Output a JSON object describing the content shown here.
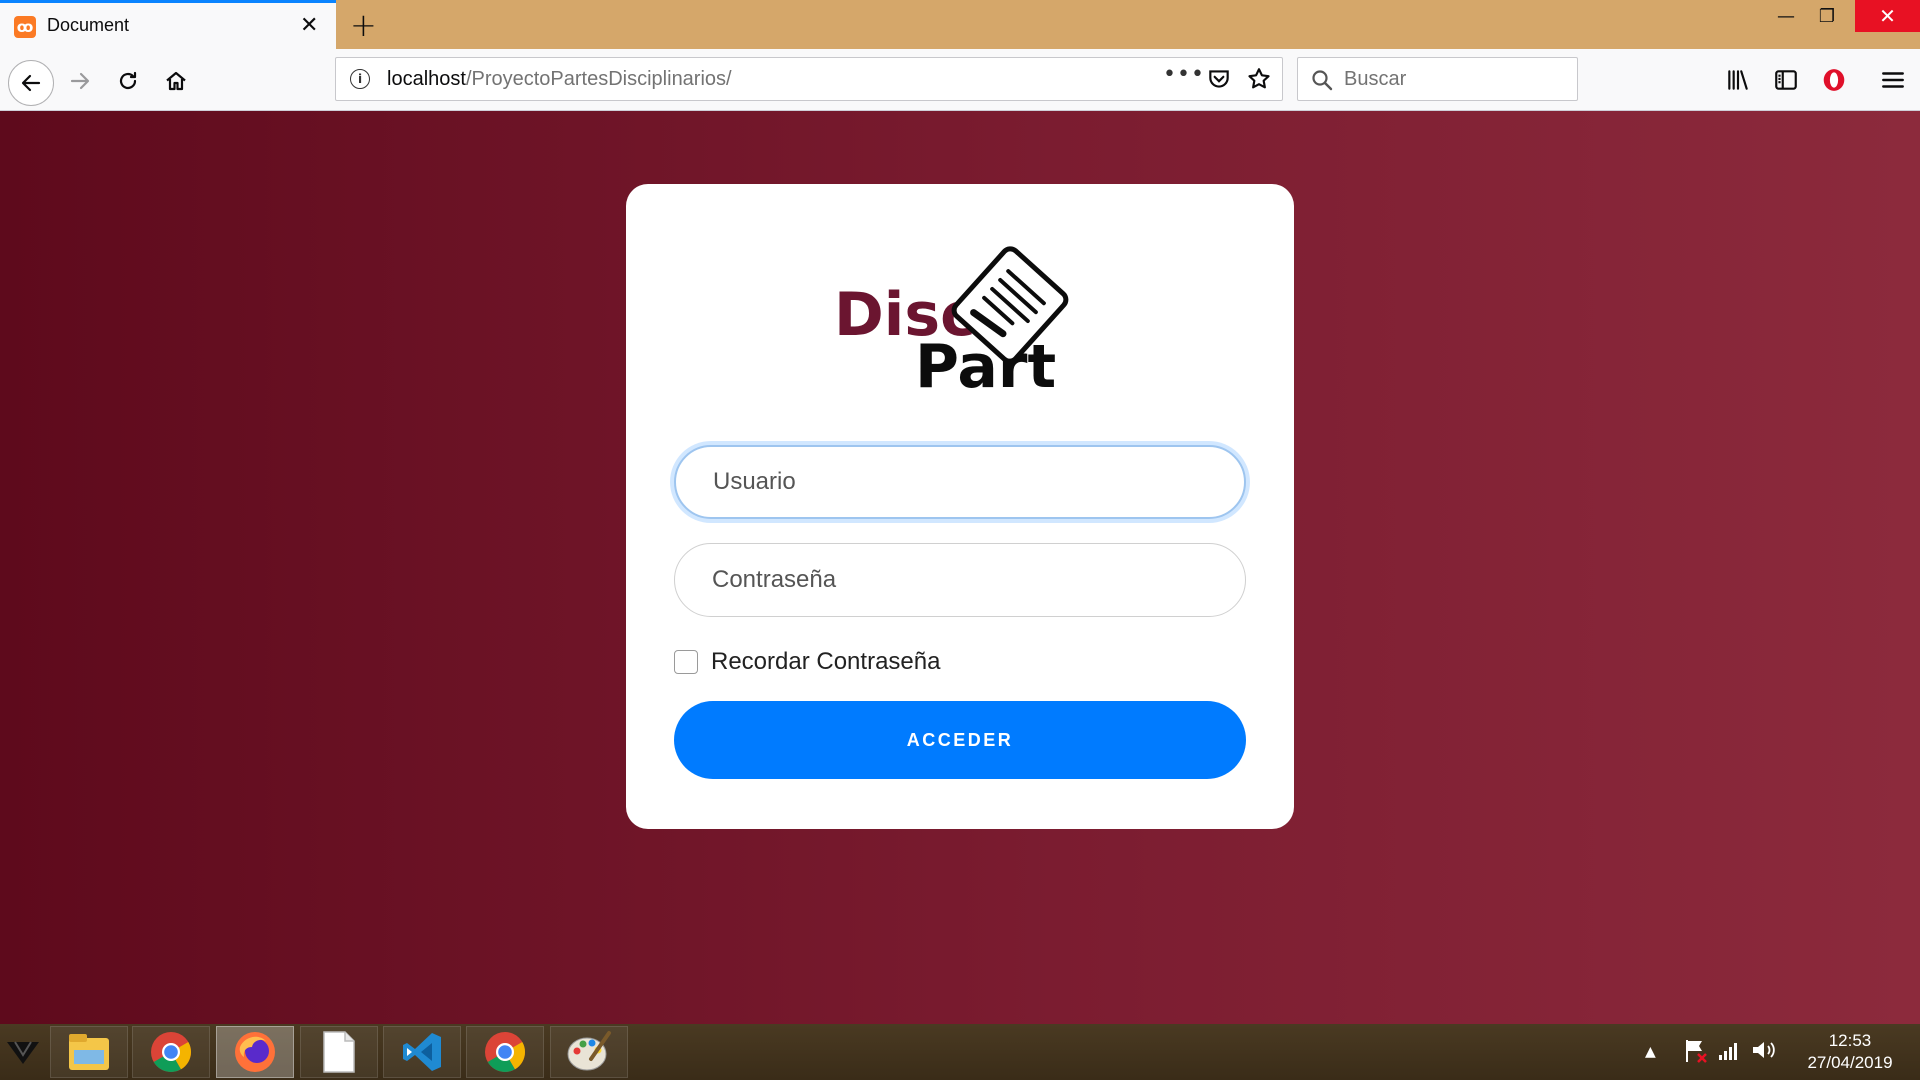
{
  "browser": {
    "tab_title": "Document",
    "tab_favicon": "xampp-icon",
    "close_glyph": "✕",
    "new_tab_glyph": "+",
    "window_controls": {
      "minimize": "—",
      "maximize": "❐",
      "close": "✕"
    },
    "url_host": "localhost",
    "url_path": "/ProyectoPartesDisciplinarios/",
    "url_more": "•••",
    "search_placeholder": "Buscar"
  },
  "login": {
    "logo_word_top": "Disci",
    "logo_word_bottom": "Part",
    "username_placeholder": "Usuario",
    "password_placeholder": "Contraseña",
    "remember_label": "Recordar Contraseña",
    "submit_label": "ACCEDER"
  },
  "colors": {
    "accent": "#007bff",
    "logo_maroon": "#6b1530",
    "background_start": "#5e0a1c",
    "background_end": "#8c2a3c",
    "tab_highlight": "#0a84ff"
  },
  "taskbar": {
    "apps": [
      "file-explorer-icon",
      "chrome-icon",
      "firefox-icon",
      "blank-document-icon",
      "vscode-icon",
      "chrome-icon",
      "paint-icon"
    ],
    "active_app": "firefox-icon",
    "time": "12:53",
    "date": "27/04/2019"
  }
}
